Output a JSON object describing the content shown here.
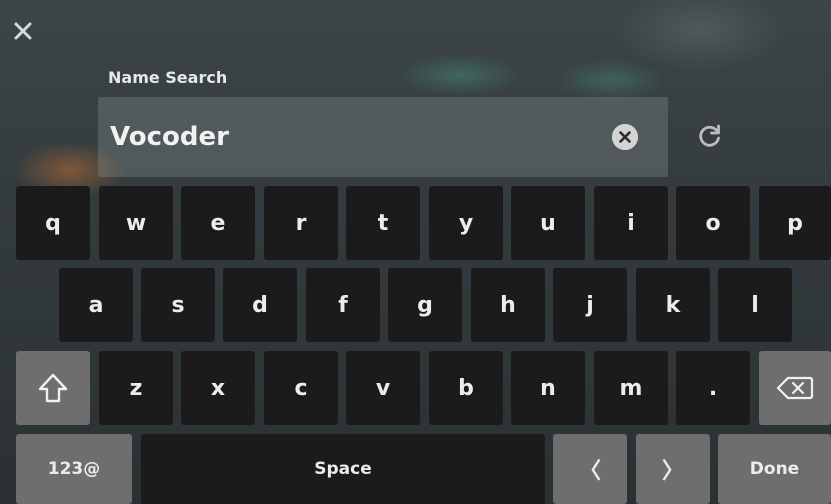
{
  "search": {
    "label": "Name Search",
    "value": "Vocoder"
  },
  "icons": {
    "close": "close-icon",
    "clear": "clear-circle-icon",
    "refresh": "refresh-icon",
    "shift": "shift-arrow-icon",
    "backspace": "backspace-icon"
  },
  "keyboard": {
    "row1": [
      "q",
      "w",
      "e",
      "r",
      "t",
      "y",
      "u",
      "i",
      "o",
      "p"
    ],
    "row2": [
      "a",
      "s",
      "d",
      "f",
      "g",
      "h",
      "j",
      "k",
      "l"
    ],
    "row3": [
      "z",
      "x",
      "c",
      "v",
      "b",
      "n",
      "m",
      "."
    ],
    "numbers_label": "123@",
    "space_label": "Space",
    "left_label": "〈",
    "right_label": "〉",
    "done_label": "Done"
  }
}
